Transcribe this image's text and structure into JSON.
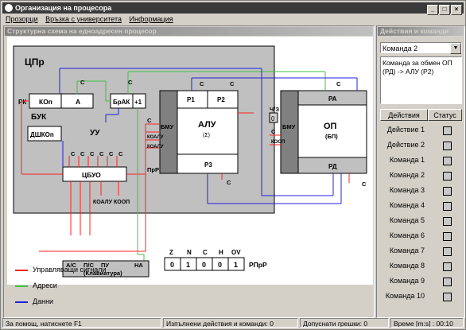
{
  "window": {
    "title": "Организация на процесора"
  },
  "menu": [
    "Прозорци",
    "Връзка с университета",
    "Информация"
  ],
  "left_panel": {
    "title": "Структурна схема на едноадресен процесор"
  },
  "diagram": {
    "cpu_label": "ЦПр",
    "buk_label": "БУК",
    "uu_label": "УУ",
    "rk_label": "РК",
    "kop_label": "КОп",
    "a_label": "А",
    "dshkop_label": "ДШКОп",
    "brak_label": "БрАК",
    "plus1_label": "+1",
    "cbuo_label": "ЦБУО",
    "alu_label": "АЛУ",
    "alu_sub": "(Σ)",
    "bmu_label": "БМУ",
    "r1_label": "Р1",
    "r2_label": "Р2",
    "r3_label": "Р3",
    "op_label": "ОП",
    "op_sub": "(БП)",
    "ra_label": "РА",
    "rd_label": "РД",
    "bmu2_label": "БМУ",
    "c_label": "С",
    "prr_label": "ПрР",
    "rw_label": "Ч/З",
    "rw_value": "0",
    "ko_alu": "КОАЛУ",
    "ko_op": "КООП",
    "ko_alu1": "КОАЛУ",
    "ko_alu2": "КОАЛУ",
    "ko_op2": "КООП",
    "keyboard": {
      "labels": [
        "А/С",
        "П/С",
        "ПУ",
        "НА"
      ],
      "caption": "(Клавиатура)"
    },
    "flags": {
      "names": [
        "Z",
        "N",
        "C",
        "H",
        "OV"
      ],
      "values": [
        "0",
        "1",
        "0",
        "0",
        "1"
      ],
      "caption": "РПрР"
    }
  },
  "legend": [
    {
      "label": "Управляващи сигнали",
      "color": "#ff2020"
    },
    {
      "label": "Адреси",
      "color": "#40c040"
    },
    {
      "label": "Данни",
      "color": "#2020e0"
    }
  ],
  "right_panel": {
    "title": "Действия и команди",
    "selected": "Команда 2",
    "description": "Команда за обмен ОП (РД) -> АЛУ (Р2)",
    "headers": [
      "Действия",
      "Статус"
    ],
    "rows": [
      "Действие 1",
      "Действие 2",
      "Команда 1",
      "Команда 2",
      "Команда 3",
      "Команда 4",
      "Команда 5",
      "Команда 6",
      "Команда 7",
      "Команда 8",
      "Команда 9",
      "Команда 10"
    ]
  },
  "status": {
    "help": "За помощ, натиснете  F1",
    "done": "Изпълнени действия и команди: 0",
    "errors": "Допуснати грешки: 0",
    "time": "Време [m:s] : 00:10"
  }
}
